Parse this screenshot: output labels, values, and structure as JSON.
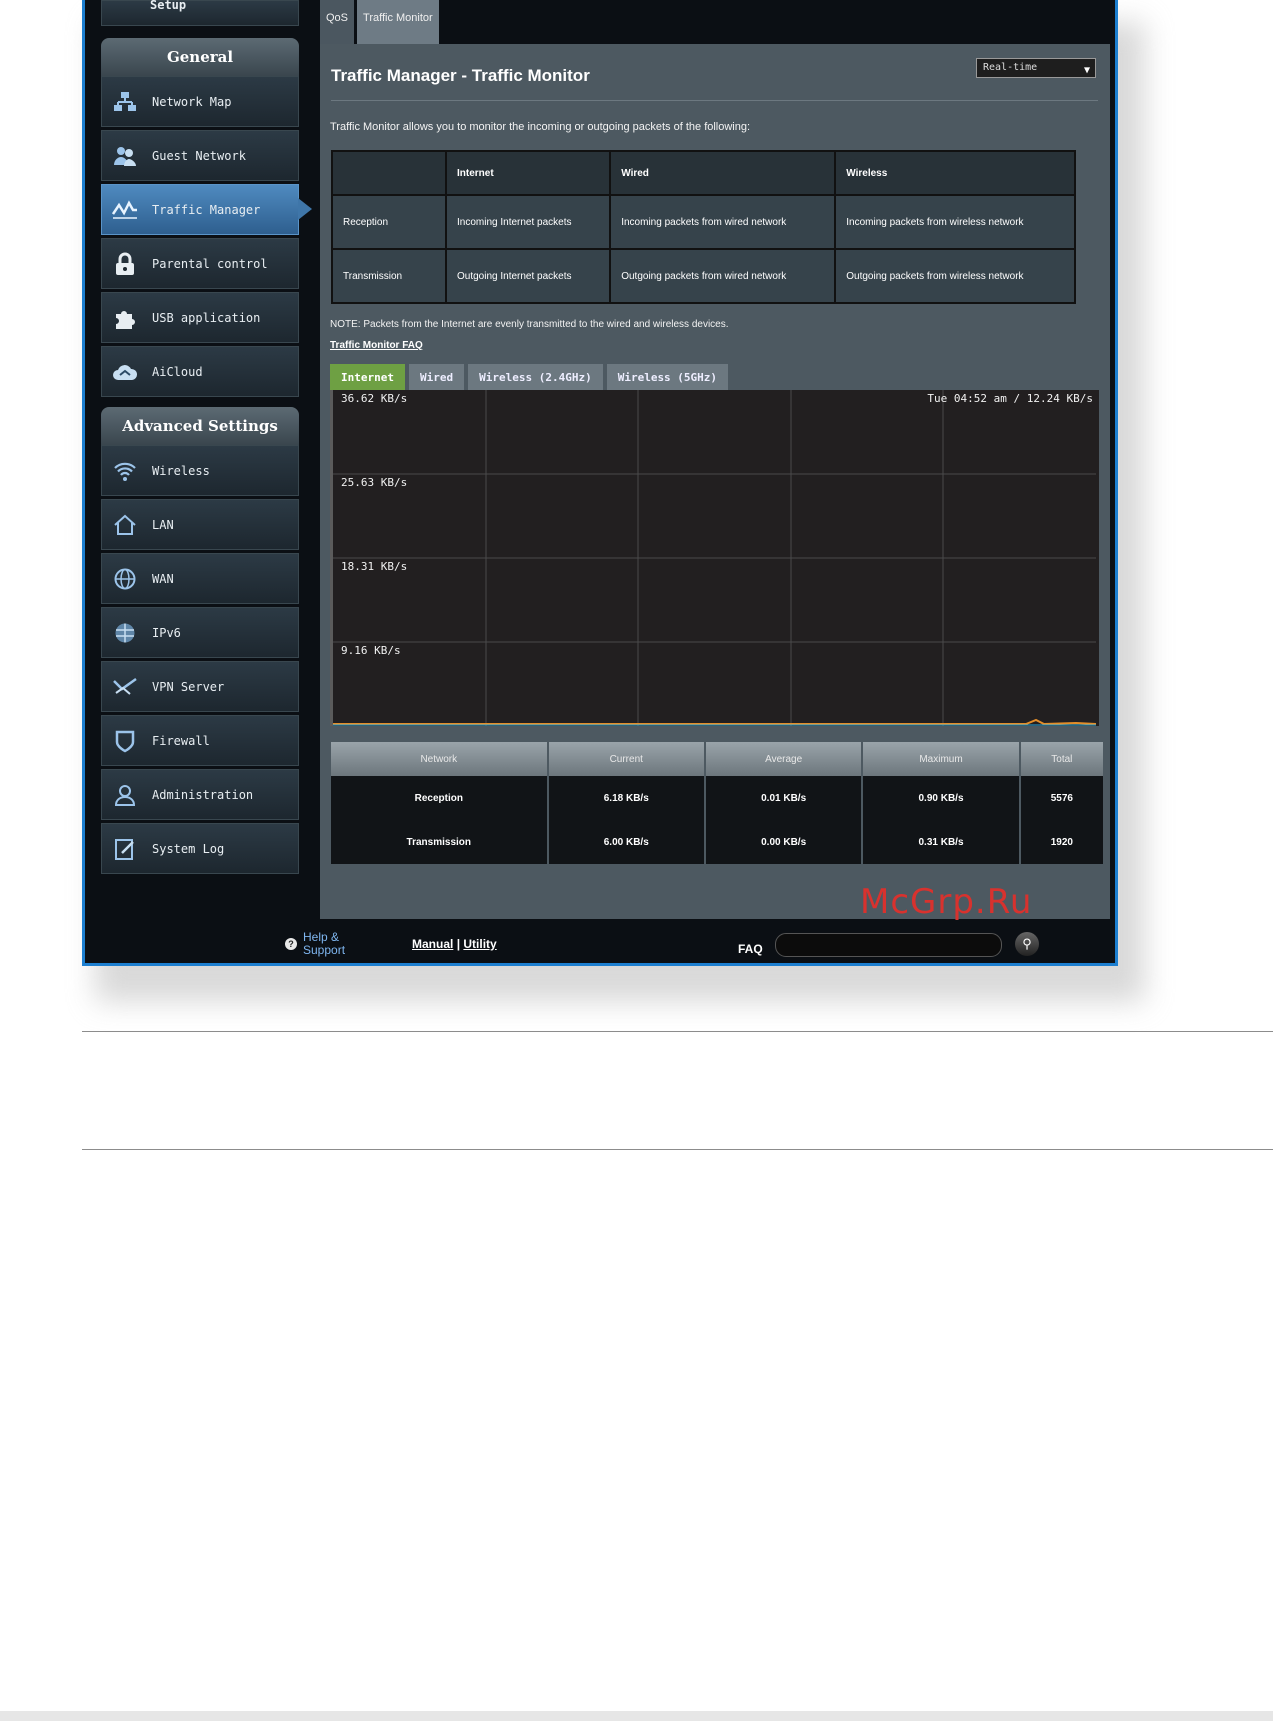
{
  "sidebar": {
    "setup_label": "Setup",
    "general_title": "General",
    "general_items": [
      {
        "label": "Network Map",
        "icon": "network-map-icon"
      },
      {
        "label": "Guest Network",
        "icon": "guest-network-icon"
      },
      {
        "label": "Traffic Manager",
        "icon": "traffic-manager-icon"
      },
      {
        "label": "Parental control",
        "icon": "lock-icon"
      },
      {
        "label": "USB application",
        "icon": "puzzle-icon"
      },
      {
        "label": "AiCloud",
        "icon": "cloud-icon"
      }
    ],
    "advanced_title": "Advanced Settings",
    "advanced_items": [
      {
        "label": "Wireless",
        "icon": "wifi-icon"
      },
      {
        "label": "LAN",
        "icon": "home-icon"
      },
      {
        "label": "WAN",
        "icon": "globe-icon"
      },
      {
        "label": "IPv6",
        "icon": "ipv6-globe-icon"
      },
      {
        "label": "VPN Server",
        "icon": "vpn-icon"
      },
      {
        "label": "Firewall",
        "icon": "shield-icon"
      },
      {
        "label": "Administration",
        "icon": "admin-user-icon"
      },
      {
        "label": "System Log",
        "icon": "log-icon"
      }
    ]
  },
  "top_tabs": [
    "QoS",
    "Traffic Monitor"
  ],
  "page": {
    "title": "Traffic Manager - Traffic Monitor",
    "view_select": "Real-time",
    "description": "Traffic Monitor allows you to monitor the incoming or outgoing packets of the following:",
    "note": "NOTE: Packets from the Internet are evenly transmitted to the wired and wireless devices.",
    "faq_link": "Traffic Monitor FAQ"
  },
  "legend_table": {
    "headers": [
      "",
      "Internet",
      "Wired",
      "Wireless"
    ],
    "rows": [
      {
        "label": "Reception",
        "cells": [
          "Incoming Internet packets",
          "Incoming packets from wired network",
          "Incoming packets from wireless network"
        ]
      },
      {
        "label": "Transmission",
        "cells": [
          "Outgoing Internet packets",
          "Outgoing packets from wired network",
          "Outgoing packets from wireless network"
        ]
      }
    ]
  },
  "chart_tabs": [
    "Internet",
    "Wired",
    "Wireless (2.4GHz)",
    "Wireless (5GHz)"
  ],
  "chart_data": {
    "type": "area",
    "y_tick_labels": [
      "36.62 KB/s",
      "25.63 KB/s",
      "18.31 KB/s",
      "9.16 KB/s"
    ],
    "stamp": "Tue 04:52 am / 12.24 KB/s",
    "grid": true,
    "colors": {
      "reception": "#e48e2a",
      "transmission": "#2aaae0",
      "background": "#221f20",
      "grid": "#4a4a4a"
    }
  },
  "stats_table": {
    "headers": [
      "Network",
      "Current",
      "Average",
      "Maximum",
      "Total"
    ],
    "rows": [
      {
        "network": "Reception",
        "current": "6.18 KB/s",
        "average": "0.01 KB/s",
        "maximum": "0.90 KB/s",
        "total": "5576"
      },
      {
        "network": "Transmission",
        "current": "6.00 KB/s",
        "average": "0.00 KB/s",
        "maximum": "0.31 KB/s",
        "total": "1920"
      }
    ]
  },
  "watermark": "McGrp.Ru",
  "footer": {
    "help": "Help &",
    "support": "Support",
    "manual": "Manual",
    "separator": "|",
    "utility": "Utility",
    "faq_label": "FAQ"
  }
}
